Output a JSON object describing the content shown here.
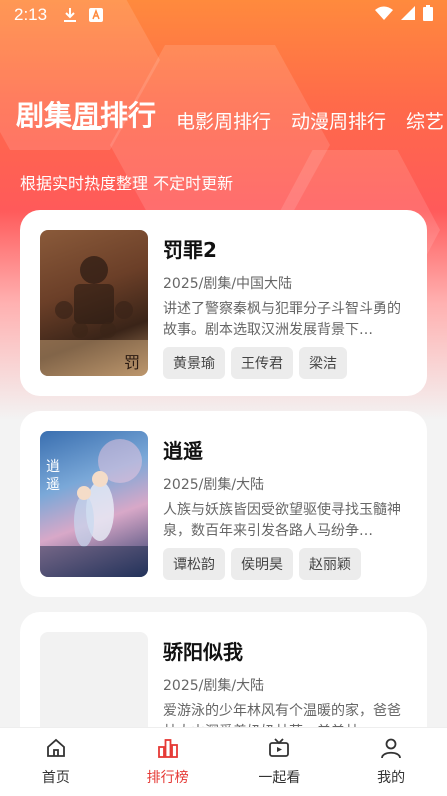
{
  "status_bar": {
    "time": "2:13"
  },
  "tabs": [
    {
      "label": "剧集周排行",
      "active": true
    },
    {
      "label": "电影周排行",
      "active": false
    },
    {
      "label": "动漫周排行",
      "active": false
    },
    {
      "label": "综艺",
      "active": false
    }
  ],
  "subtitle": "根据实时热度整理 不定时更新",
  "items": [
    {
      "title": "罚罪2",
      "meta": "2025/剧集/中国大陆",
      "desc": "讲述了警察秦枫与犯罪分子斗智斗勇的故事。剧本选取汉洲发展背景下…",
      "tags": [
        "黄景瑜",
        "王传君",
        "梁洁"
      ]
    },
    {
      "title": "逍遥",
      "meta": "2025/剧集/大陆",
      "desc": "人族与妖族皆因受欲望驱使寻找玉髓神泉，数百年来引发各路人马纷争…",
      "tags": [
        "谭松韵",
        "侯明昊",
        "赵丽颖"
      ]
    },
    {
      "title": "骄阳似我",
      "meta": "2025/剧集/大陆",
      "desc": "爱游泳的少年林风有个温暖的家，爸爸林大山深爱着奶奶林芬，弟弟林…",
      "tags": []
    }
  ],
  "bottom_nav": [
    {
      "label": "首页",
      "icon": "home-icon",
      "active": false
    },
    {
      "label": "排行榜",
      "icon": "ranking-icon",
      "active": true
    },
    {
      "label": "一起看",
      "icon": "tv-icon",
      "active": false
    },
    {
      "label": "我的",
      "icon": "user-icon",
      "active": false
    }
  ],
  "colors": {
    "accent": "#e53935",
    "hero_top": "#ff8a3d",
    "hero_mid": "#ff5a5a"
  }
}
